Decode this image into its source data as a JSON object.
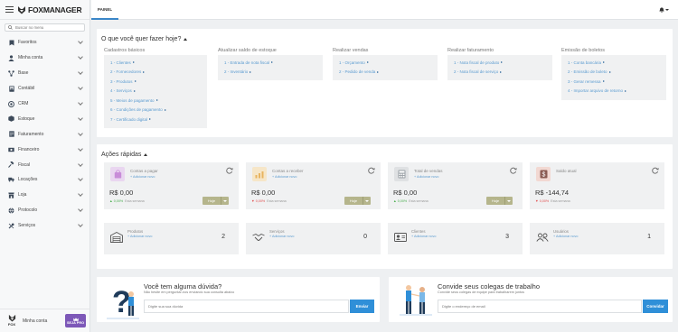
{
  "app": {
    "logo_text": "FOXMANAGER"
  },
  "search": {
    "placeholder": "Buscar no menu"
  },
  "sidebar": {
    "items": [
      {
        "label": "Favoritos",
        "icon": "bookmark-icon"
      },
      {
        "label": "Minha conta",
        "icon": "user-icon"
      },
      {
        "label": "Base",
        "icon": "network-icon"
      },
      {
        "label": "Contábil",
        "icon": "calculator-icon"
      },
      {
        "label": "CRM",
        "icon": "target-icon"
      },
      {
        "label": "Estoque",
        "icon": "box-icon"
      },
      {
        "label": "Faturamento",
        "icon": "invoice-icon"
      },
      {
        "label": "Financeiro",
        "icon": "money-icon"
      },
      {
        "label": "Fiscal",
        "icon": "gavel-icon"
      },
      {
        "label": "Locações",
        "icon": "truck-icon"
      },
      {
        "label": "Loja",
        "icon": "store-icon"
      },
      {
        "label": "Protocolo",
        "icon": "globe-icon"
      },
      {
        "label": "Serviços",
        "icon": "tools-icon"
      }
    ],
    "account_label": "Minha conta",
    "fox_label": "FOX",
    "seja_pro_label": "SEJA PRO"
  },
  "topbar": {
    "tab_label": "PAINEL"
  },
  "quick_start": {
    "title": "O que você quer fazer hoje?",
    "groups": [
      {
        "title": "Cadastros básicos",
        "items": [
          "1 - Clientes",
          "2 - Fornecedores",
          "3 - Produtos",
          "4 - Serviços",
          "5 - Meios de pagamento",
          "6 - Condições de pagamento",
          "7 - Certificado digital"
        ]
      },
      {
        "title": "Atualizar saldo de estoque",
        "items": [
          "1 - Entrada de nota fiscal",
          "2 - Inventário"
        ]
      },
      {
        "title": "Realizar vendas",
        "items": [
          "1 - Orçamento",
          "2 - Pedido de venda"
        ]
      },
      {
        "title": "Realizar faturamento",
        "items": [
          "1 - Nota fiscal de produto",
          "2 - Nota fiscal de serviço"
        ]
      },
      {
        "title": "Emissão de boletos",
        "items": [
          "1 - Conta bancária",
          "2 - Emissão de boleto",
          "3 - Gerar remessa",
          "4 - Importar arquivo de retorno"
        ]
      }
    ]
  },
  "quick_actions": {
    "title": "Ações rápidas",
    "finance": [
      {
        "title": "Contas a pagar",
        "add": "Adicionar novo",
        "value": "R$ 0,00",
        "pct": "0,00%",
        "trend": "up",
        "period": "Esta semana",
        "filter": "Hoje",
        "icon": "bag-icon",
        "color": "#e9d6f0"
      },
      {
        "title": "Contas a receber",
        "add": "Adicionar novo",
        "value": "R$ 0,00",
        "pct": "0,00%",
        "trend": "down",
        "period": "Esta semana",
        "filter": "Hoje",
        "icon": "chart-icon",
        "color": "#f6e6c8"
      },
      {
        "title": "Total de vendas",
        "add": "Adicionar novo",
        "value": "R$ 0,00",
        "pct": "0,00%",
        "trend": "up",
        "period": "Esta semana",
        "filter": "Hoje",
        "icon": "calculator-icon",
        "color": "#dfe1e3"
      },
      {
        "title": "Saldo atual",
        "add": "",
        "value": "R$ -144,74",
        "pct": "0,00%",
        "trend": "down",
        "period": "Esta semana",
        "filter": "",
        "icon": "dollar-icon",
        "color": "#f2d8d2"
      }
    ],
    "registers": [
      {
        "title": "Produtos",
        "add": "Adicionar novo",
        "count": "2",
        "icon": "warehouse-icon"
      },
      {
        "title": "Serviços",
        "add": "Adicionar novo",
        "count": "0",
        "icon": "handshake-icon"
      },
      {
        "title": "Clientes",
        "add": "Adicionar novo",
        "count": "3",
        "icon": "id-card-icon"
      },
      {
        "title": "Usuários",
        "add": "Adicionar novo",
        "count": "1",
        "icon": "users-icon"
      }
    ]
  },
  "help": {
    "title": "Você tem alguma dúvida?",
    "subtitle": "Não hesite em perguntar-nos enviando sua consulta abaixo",
    "placeholder": "Digite sua sua dúvida",
    "button": "Enviar"
  },
  "invite": {
    "title": "Convide seus colegas de trabalho",
    "subtitle": "Convide seus colegas de equipe para trabalharem juntos",
    "placeholder": "Digite o endereço de email",
    "button": "Convidar"
  }
}
